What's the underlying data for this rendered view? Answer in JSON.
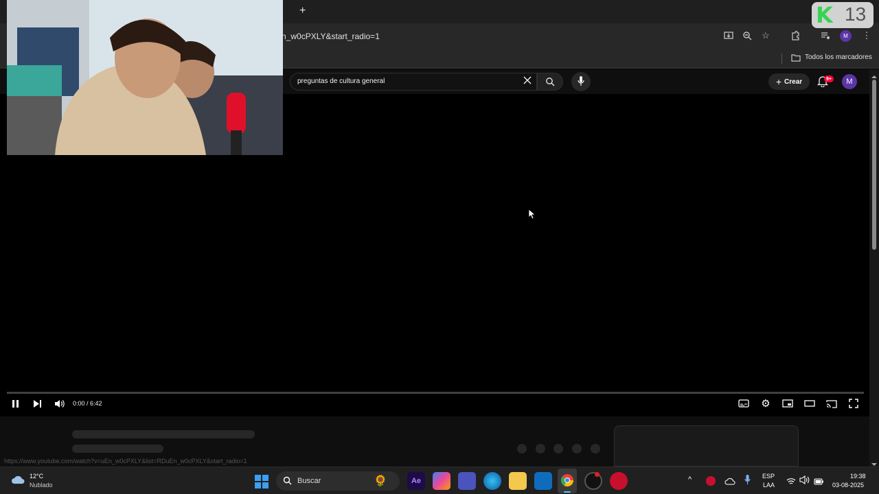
{
  "browser": {
    "new_tab_symbol": "+",
    "url_text": "n_w0cPXLY&start_radio=1",
    "bookmarks_label": "Todos los marcadores",
    "status_url": "https://www.youtube.com/watch?v=uEn_w0cPXLY&list=RDuEn_w0cPXLY&start_radio=1"
  },
  "youtube": {
    "search_value": "preguntas de cultura general",
    "create_label": "Crear",
    "notification_badge": "9+",
    "avatar_letter": "M",
    "profile_letter": "M"
  },
  "player": {
    "time_display": "0:00 / 6:42",
    "progress_fraction": 0.0
  },
  "overlay": {
    "logo_letter": "K",
    "logo_number": "13"
  },
  "taskbar": {
    "weather_temp": "12°C",
    "weather_desc": "Nublado",
    "search_placeholder": "Buscar",
    "lang_top": "ESP",
    "lang_bottom": "LAA",
    "time": "19:38",
    "date": "03-08-2025",
    "ae_label": "Ae"
  },
  "colors": {
    "accent_red": "#ff0033",
    "avatar_purple": "#5c35a8",
    "logo_green": "#39d353"
  }
}
